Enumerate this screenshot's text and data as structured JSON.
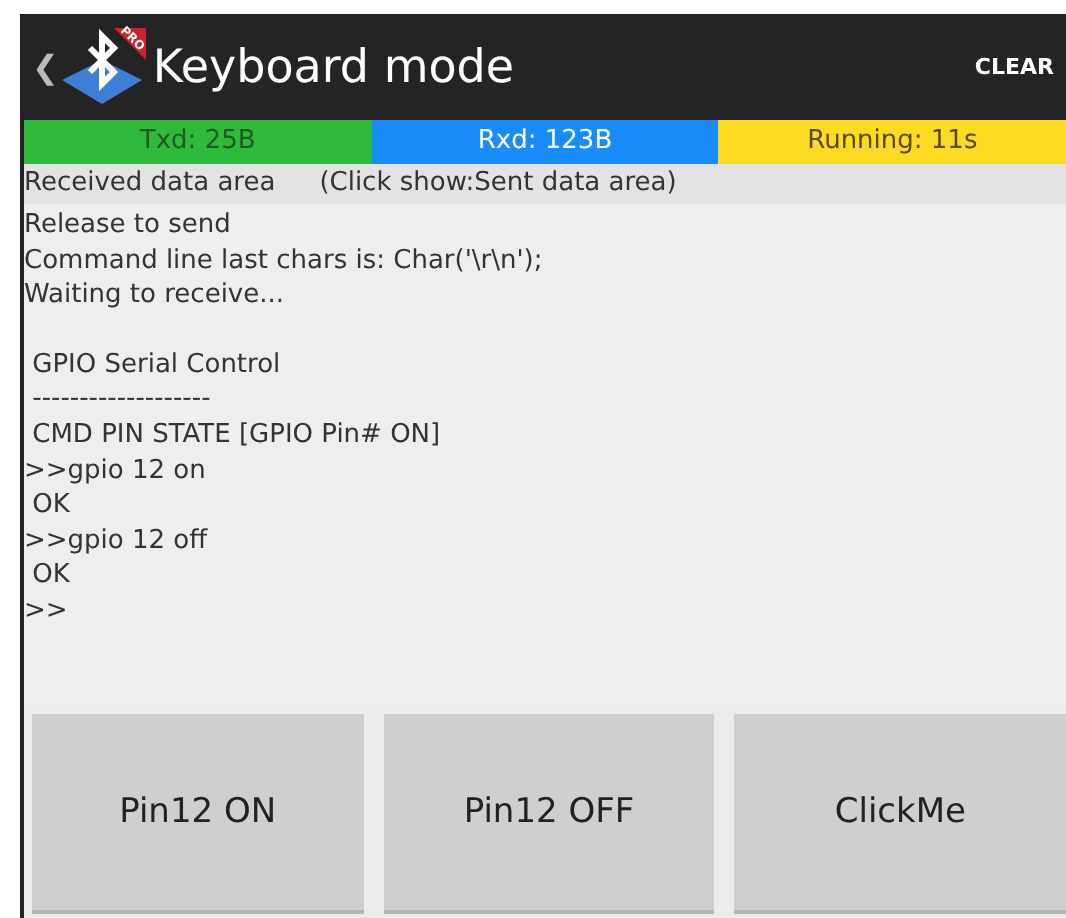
{
  "action_bar": {
    "back": "❮",
    "badge": "PRO",
    "title": "Keyboard mode",
    "action": "CLEAR"
  },
  "stats": [
    {
      "text": "Txd: 25B",
      "color": "#2fba3c"
    },
    {
      "text": "Rxd: 123B",
      "color": "#1a8cfa"
    },
    {
      "text": "Running: 11s",
      "color": "#fcdc22"
    }
  ],
  "area": {
    "label": "Received data area",
    "hint": "(Click show:Sent data area)"
  },
  "log_blocks": [
    {
      "lines": [
        "Release to send",
        "Command line last chars is: Char('\\r\\n');",
        "Waiting to receive..."
      ]
    },
    {
      "lines": [
        " GPIO Serial Control",
        " -------------------",
        " CMD PIN STATE [GPIO Pin# ON]",
        ">>gpio 12 on",
        " OK",
        ">>gpio 12 off",
        " OK",
        ">>"
      ]
    }
  ],
  "buttons": [
    "Pin12 ON",
    "Pin12 OFF",
    "ClickMe"
  ]
}
